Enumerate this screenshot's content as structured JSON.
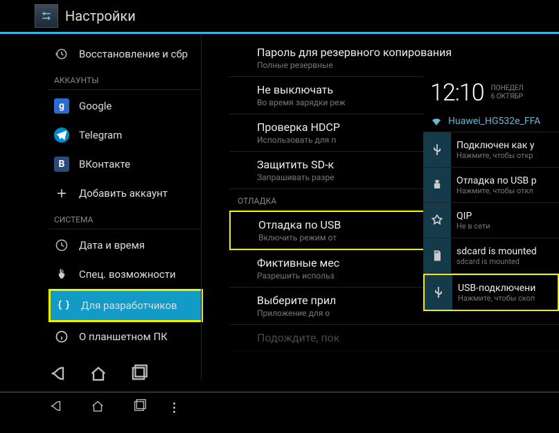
{
  "header": {
    "title": "Настройки"
  },
  "sidebar": {
    "restore": "Восстановление и сбр",
    "section_accounts": "АККАУНТЫ",
    "google": "Google",
    "telegram": "Telegram",
    "vk": "ВКонтакте",
    "add_account": "Добавить аккаунт",
    "section_system": "СИСТЕМА",
    "datetime": "Дата и время",
    "accessibility": "Спец. возможности",
    "devopts": "Для разработчиков",
    "about": "О планшетном ПК"
  },
  "main": {
    "backup_pwd": {
      "title": "Пароль для резервного копирования",
      "sub": "Полные резервные"
    },
    "stay_awake": {
      "title": "Не выключать",
      "sub": "Во время зарядки реж"
    },
    "hdcp": {
      "title": "Проверка HDCP",
      "sub": "Использовать для п"
    },
    "sdcard": {
      "title": "Защитить SD-к",
      "sub": "Запрашивать разре"
    },
    "section_debug": "ОТЛАДКА",
    "usb_debug": {
      "title": "Отладка по USB",
      "sub": "Включить режим от"
    },
    "mock_loc": {
      "title": "Фиктивные мес",
      "sub": "Разрешить использ"
    },
    "select_app": {
      "title": "Выберите прил",
      "sub": "Приложение для о"
    },
    "wait": {
      "title": "Подождите, пок"
    }
  },
  "clock": {
    "time": "12:10",
    "day": "ПОНЕДЕЛ",
    "date": "6 ОКТЯБР"
  },
  "wifi": "Huawei_HG532e_FFA",
  "notifications": {
    "connected": {
      "title": "Подключен как у",
      "sub": "Нажмите, чтобы откр"
    },
    "usb_debug": {
      "title": "Отладка по USB р",
      "sub": "Нажмите, чтобы откл"
    },
    "qip": {
      "title": "QIP",
      "sub": "Не в сети"
    },
    "sdcard": {
      "title": "sdcard is mounted",
      "sub": "sdcard is mounted"
    },
    "usb_conn": {
      "title": "USB-подключени",
      "sub": "Нажмите, чтобы скоп"
    }
  }
}
